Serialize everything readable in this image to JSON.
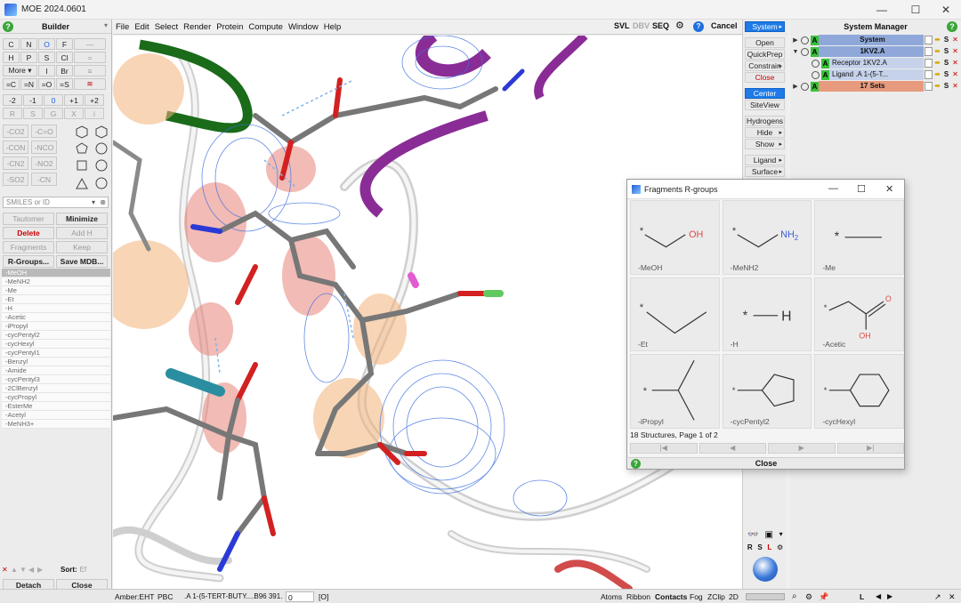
{
  "window": {
    "title": "MOE 2024.0601",
    "minimize": "—",
    "maximize": "☐",
    "close": "✕"
  },
  "builder": {
    "title": "Builder",
    "help": "?",
    "element_rows": [
      [
        "C",
        "N",
        "O",
        "F",
        "—"
      ],
      [
        "H",
        "P",
        "S",
        "Cl",
        "="
      ],
      [
        "More ▾",
        "I",
        "Br",
        "≡"
      ],
      [
        "=C",
        "=N",
        "=O",
        "=S",
        "≋"
      ],
      [
        "-2",
        "-1",
        "0",
        "+1",
        "+2"
      ],
      [
        "R",
        "S",
        "G",
        "X",
        "i"
      ]
    ],
    "group_rows": [
      [
        "-CO2",
        "-C=O"
      ],
      [
        "-CON",
        "-NCO"
      ],
      [
        "-CN2",
        "-NO2"
      ],
      [
        "-SO2",
        "-CN"
      ]
    ],
    "smiles_placeholder": "SMILES or ID",
    "tautomer": "Tautomer",
    "minimize": "Minimize",
    "delete": "Delete",
    "add_h": "Add H",
    "fragments": "Fragments",
    "keep": "Keep",
    "rgroups": "R-Groups...",
    "save_mdb": "Save MDB...",
    "rgroup_list": [
      "-MeOH",
      "-MeNH2",
      "-Me",
      "-Et",
      "-H",
      "-Acetic",
      "-iPropyl",
      "-cycPentyl2",
      "-cycHexyl",
      "-cycPentyl1",
      "-Benzyl",
      "-Amide",
      "-cycPentyl3",
      "-2ClBenzyl",
      "-cycPropyl",
      "-EsterMe",
      "-Acetyl",
      "-MeNH3+"
    ],
    "sort_label": "Sort:",
    "sort_value": "Ef",
    "detach": "Detach",
    "close": "Close"
  },
  "menubar": {
    "items": [
      "File",
      "Edit",
      "Select",
      "Render",
      "Protein",
      "Compute",
      "Window",
      "Help"
    ],
    "svl": "SVL",
    "dbv": "DBV",
    "seq": "SEQ",
    "cancel": "Cancel"
  },
  "commands": {
    "system": "System",
    "items": [
      "Open",
      "QuickPrep",
      "Constrain",
      "Close"
    ],
    "center": "Center",
    "siteview": "SiteView",
    "items2": [
      "Hydrogens",
      "Hide",
      "Show"
    ],
    "items3": [
      "Ligand",
      "Surface"
    ],
    "bottom_labels": [
      "R",
      "S",
      "L"
    ]
  },
  "sysman": {
    "title": "System Manager",
    "rows": [
      {
        "name": "System",
        "color": "#8fa8d9",
        "bold": true
      },
      {
        "name": "1KV2.A",
        "color": "#8fa8d9",
        "bold": true
      },
      {
        "name": "Receptor 1KV2.A",
        "color": "#c5d2ea",
        "bold": false
      },
      {
        "name": "Ligand .A 1-(5-T...",
        "color": "#c5d2ea",
        "bold": false
      },
      {
        "name": "17 Sets",
        "color": "#e89a7e",
        "bold": true
      }
    ]
  },
  "fragments_dialog": {
    "title": "Fragments R-groups",
    "cells": [
      "-MeOH",
      "-MeNH2",
      "-Me",
      "-Et",
      "-H",
      "-Acetic",
      "-iPropyl",
      "-cycPentyl2",
      "-cycHexyl"
    ],
    "status": "18 Structures,  Page 1 of 2",
    "close": "Close",
    "atoms": {
      "oh": "OH",
      "nh2": "NH",
      "nh2_sub": "2",
      "h": "H",
      "o": "O",
      "acid_oh": "OH",
      "star": "*"
    }
  },
  "statusbar": {
    "ff": "Amber:EHT",
    "pbc": "PBC",
    "ligand": ".A 1-(5-TERT-BUTY....B96 391.",
    "value": "0",
    "bracket": "[O]",
    "atoms": "Atoms",
    "ribbon": "Ribbon",
    "contacts": "Contacts",
    "fog": "Fog",
    "zclip": "ZClip",
    "two_d": "2D",
    "l": "L"
  }
}
